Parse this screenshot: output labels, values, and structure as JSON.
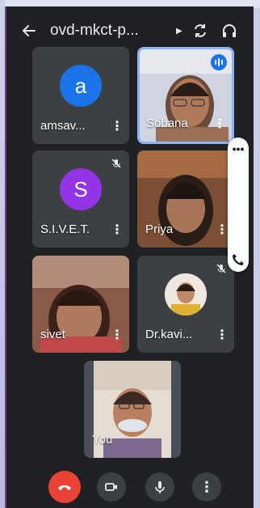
{
  "topbar": {
    "meeting_title": "ovd-mkct-p...",
    "back_icon": "arrow-left-icon",
    "switch_camera_icon": "switch-camera-icon",
    "audio_output_icon": "headphones-icon"
  },
  "participants": [
    {
      "name": "amsav...",
      "avatar_letter": "a",
      "avatar_color": "#1a73e8",
      "muted": false,
      "speaking": false,
      "video": false
    },
    {
      "name": "Sobana",
      "video": true,
      "speaking": true,
      "active": true
    },
    {
      "name": "S.I.V.E.T.",
      "avatar_letter": "S",
      "avatar_color": "#9334e6",
      "muted": true,
      "video": false
    },
    {
      "name": "Priya",
      "video": true,
      "muted": false
    },
    {
      "name": "sivet",
      "video": true,
      "muted": false
    },
    {
      "name": "Dr.kavi...",
      "video": false,
      "muted": true,
      "photo": true
    }
  ],
  "self_tile": {
    "name": "You"
  },
  "controls": {
    "end_call_icon": "phone-hangup-icon",
    "camera_icon": "video-camera-icon",
    "mic_icon": "microphone-icon",
    "more_icon": "more-vertical-icon"
  },
  "colors": {
    "background": "#202124",
    "tile": "#3c4043",
    "active_border": "#8ab4f8",
    "end_call": "#ea4335",
    "speaking": "#1a73e8"
  }
}
